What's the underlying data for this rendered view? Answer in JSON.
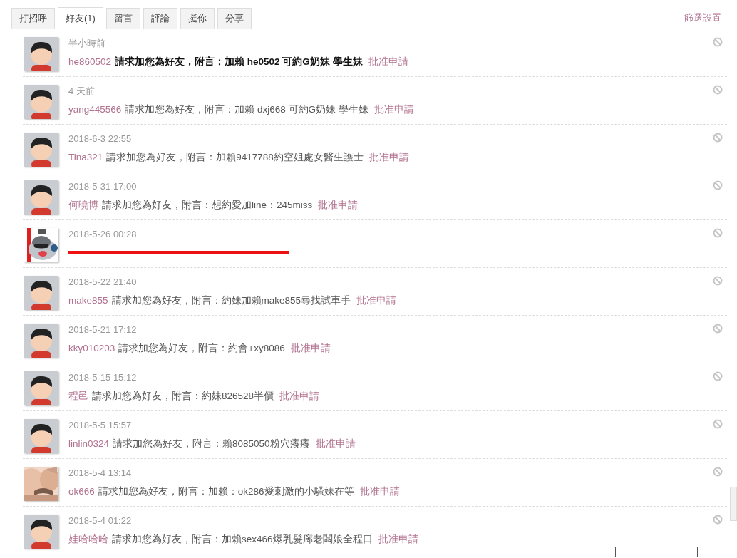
{
  "tabs": [
    {
      "label": "打招呼",
      "selected": false
    },
    {
      "label": "好友(1)",
      "selected": true
    },
    {
      "label": "留言",
      "selected": false
    },
    {
      "label": "評論",
      "selected": false
    },
    {
      "label": "挺你",
      "selected": false
    },
    {
      "label": "分享",
      "selected": false
    }
  ],
  "filter_link": "篩選設置",
  "requests": [
    {
      "avatar": {
        "kind": "default"
      },
      "time": "半小時前",
      "user": "he860502",
      "message": "請求加您為好友，附言：加賴 he0502 可約G奶妹 學生妹",
      "action": "批准申請",
      "unread": true
    },
    {
      "avatar": {
        "kind": "default"
      },
      "time": "4 天前",
      "user": "yang445566",
      "message": "請求加您為好友，附言：加賴 dxj668 可約G奶妹 學生妹",
      "action": "批准申請",
      "unread": false
    },
    {
      "avatar": {
        "kind": "default"
      },
      "time": "2018-6-3 22:55",
      "user": "Tina321",
      "message": "請求加您為好友，附言：加賴9417788約空姐處女醫生護士",
      "action": "批准申請",
      "unread": false
    },
    {
      "avatar": {
        "kind": "default"
      },
      "time": "2018-5-31 17:00",
      "user": "何曉博",
      "message": "請求加您為好友，附言：想約愛加line：245miss",
      "action": "批准申請",
      "unread": false
    },
    {
      "time": "2018-5-26 00:28",
      "redacted": true
    },
    {
      "avatar": {
        "kind": "default"
      },
      "time": "2018-5-22 21:40",
      "user": "make855",
      "message": "請求加您為好友，附言：約妹加賴make855尋找試車手",
      "action": "批准申請",
      "unread": false
    },
    {
      "avatar": {
        "kind": "default"
      },
      "time": "2018-5-21 17:12",
      "user": "kky010203",
      "message": "請求加您為好友，附言：約會+xy8086",
      "action": "批准申請",
      "unread": false
    },
    {
      "avatar": {
        "kind": "default"
      },
      "time": "2018-5-15 15:12",
      "user": "程邑",
      "message": "請求加您為好友，附言：約妹826528半價",
      "action": "批准申請",
      "unread": false
    },
    {
      "avatar": {
        "kind": "default"
      },
      "time": "2018-5-5 15:57",
      "user": "linlin0324",
      "message": "請求加您為好友，附言：賴8085050粉穴癢癢",
      "action": "批准申請",
      "unread": false
    },
    {
      "time": "2018-5-4 13:14",
      "user": "ok666",
      "message": "請求加您為好友，附言：加賴：ok286愛刺激的小騷妹在等",
      "action": "批准申請",
      "unread": false
    },
    {
      "avatar": {
        "kind": "default"
      },
      "time": "2018-5-4 01:22",
      "user": "娃哈哈哈",
      "message": "請求加您為好友，附言：加賴sex466爆乳髮廊老闆娘全程口",
      "action": "批准申請",
      "unread": false
    }
  ]
}
